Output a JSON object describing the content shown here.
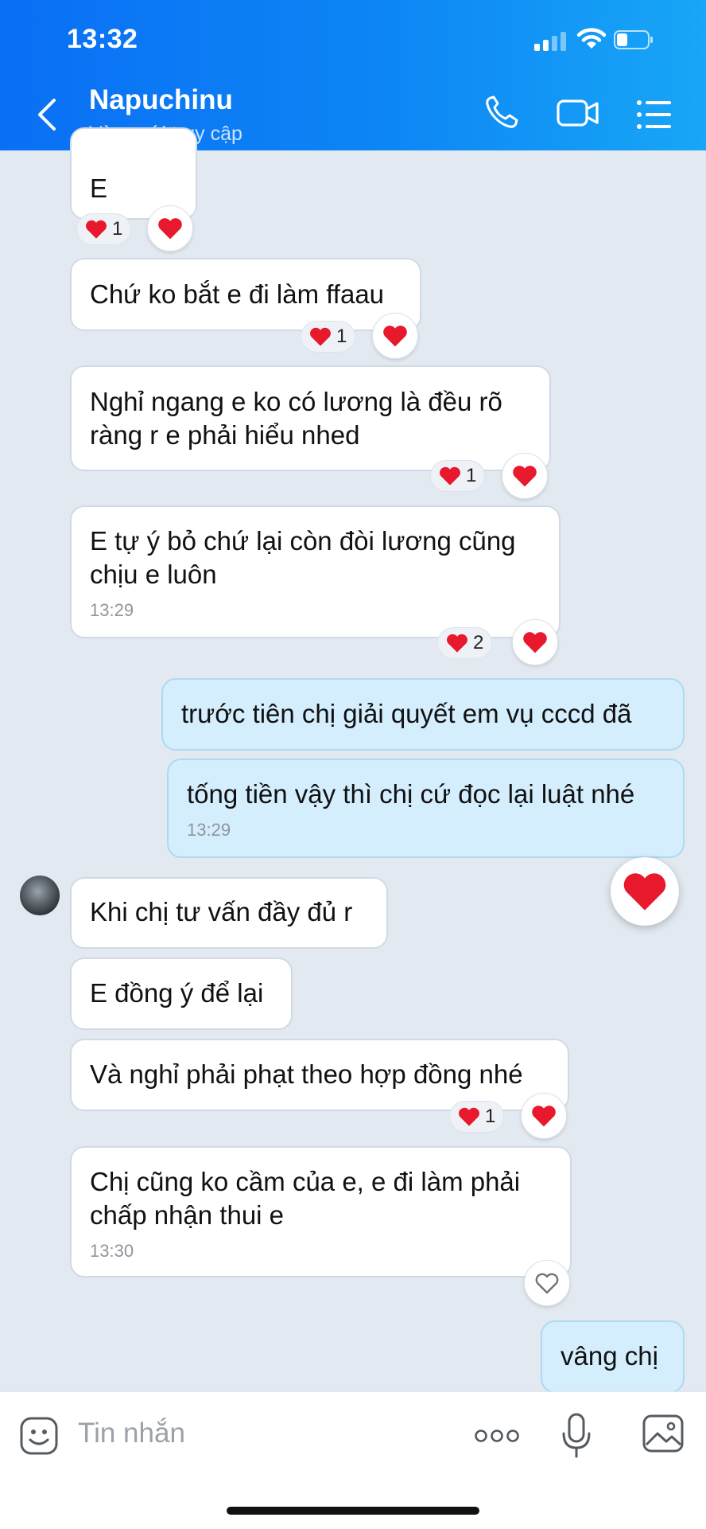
{
  "status_bar": {
    "time": "13:32"
  },
  "header": {
    "contact_name": "Napuchinu",
    "contact_status": "Vừa mới truy cập",
    "icons": [
      "back-icon",
      "phone-icon",
      "video-call-icon",
      "menu-list-icon"
    ]
  },
  "messages": [
    {
      "text": "E",
      "reaction_count": "1"
    },
    {
      "text": "Chứ ko bắt e đi làm ffaau",
      "reaction_count": "1"
    },
    {
      "text": "Nghỉ ngang e ko có lương là đều rõ\nràng r e phải hiểu nhed",
      "reaction_count": "1"
    },
    {
      "text": "E tự ý bỏ chứ lại còn đòi lương cũng\nchịu e luôn",
      "time": "13:29",
      "reaction_count": "2"
    },
    {
      "text": "trước tiên chị giải quyết em vụ cccd đã"
    },
    {
      "text": "tống tiền vậy thì chị cứ đọc lại luật nhé",
      "time": "13:29"
    },
    {
      "text": "Khi chị tư vấn đầy đủ r"
    },
    {
      "text": "E đồng ý để lại"
    },
    {
      "text": "Và nghỉ phải phạt theo hợp đồng nhé",
      "reaction_count": "1"
    },
    {
      "text": "Chị cũng ko cầm của e, e đi làm phải\nchấp nhận thui e",
      "time": "13:30"
    },
    {
      "text": "vâng chị"
    }
  ],
  "input": {
    "placeholder": "Tin nhắn"
  },
  "colors": {
    "header_start": "#0a6ff5",
    "header_end": "#18a6f6",
    "sent_bubble": "#d5eefe",
    "heart": "#e8192c"
  }
}
